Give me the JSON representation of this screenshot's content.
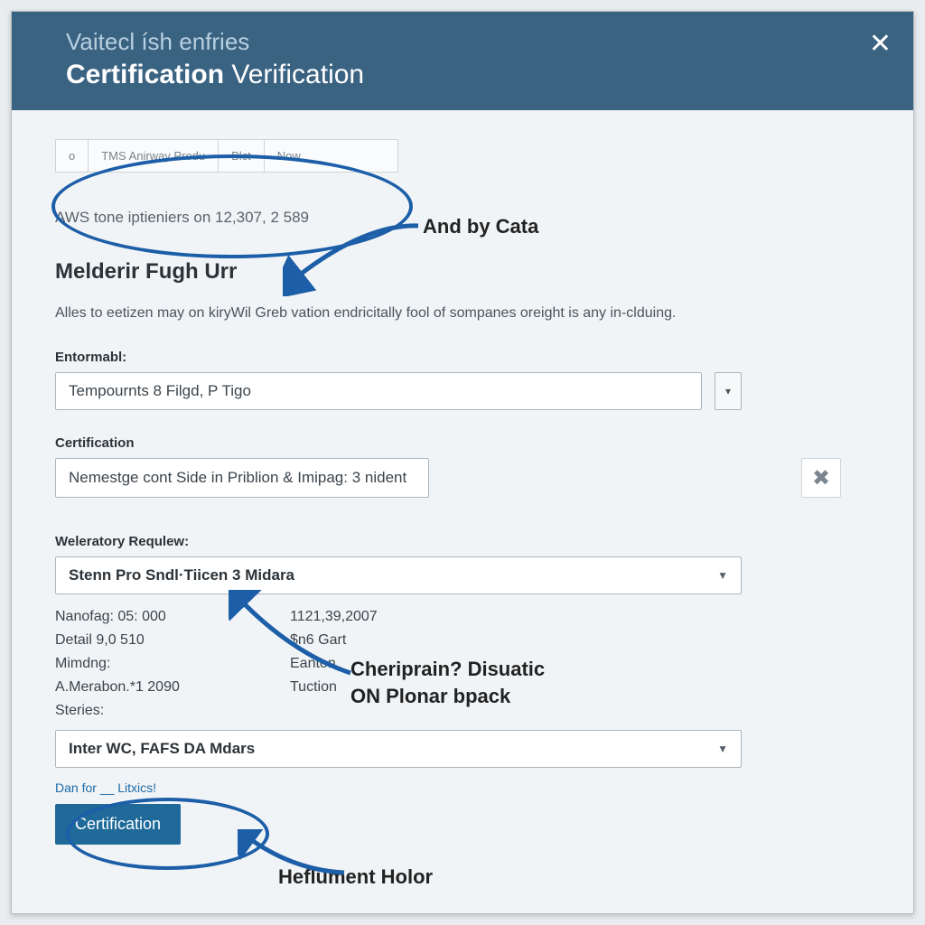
{
  "titlebar": {
    "subtitle": "Vaitecl ísh enfries",
    "title_bold": "Certification",
    "title_rest": " Verification"
  },
  "tabs": {
    "t0": "o",
    "t1": "TMS Anirway Produ",
    "t2": "Blct",
    "t3": "Now"
  },
  "info_line": "AWS tone iptieniers on 12,307, 2 589",
  "section_heading": "Melderir Fugh Urr",
  "description": "Alles to eetizen may on kiryWil Greb vation endricitally fool of sompanes oreight is any in-clduing.",
  "field1": {
    "label": "Entormabl:",
    "value": "Tempournts 8 Filgd, P Tigo"
  },
  "field2": {
    "label": "Certification",
    "value": "Nemestge cont Side in Priblion & Imipag: 3 nident"
  },
  "select_group": {
    "label": "Weleratory Requlew:",
    "value": "Stenn Pro Sndl·Tiicen 3 Midara"
  },
  "details": {
    "r0": {
      "lab": "Nanofag: 05: 000",
      "val": "1121,39,2007"
    },
    "r1": {
      "lab": "Detail 9,0 510",
      "val": "$n6 Gart"
    },
    "r2": {
      "lab": "Mimdng:",
      "val": "Eanton"
    },
    "r3": {
      "lab": "A.Merabon.*1 2090",
      "val": "Tuction"
    },
    "r4": {
      "lab": "Steries:",
      "val": ""
    }
  },
  "select2": "Inter WC, FAFS DA Mdars",
  "link": "Dan for __ Litxics!",
  "primary_button": "Certification",
  "annotations": {
    "a1": "And by Cata",
    "a2": "Cheriprain? Disuatic",
    "a3": "ON Plonar bpack",
    "a4": "Heflument Holor"
  }
}
